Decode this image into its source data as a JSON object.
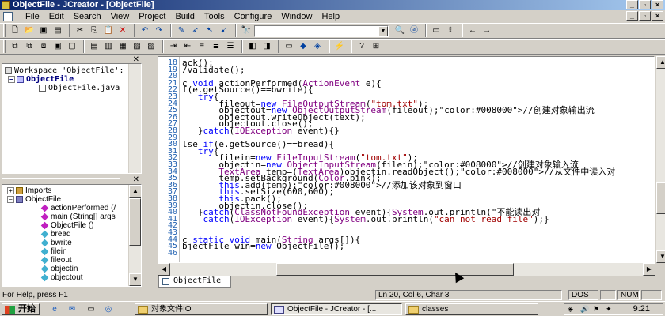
{
  "window": {
    "title": "ObjectFile - JCreator - [ObjectFile]"
  },
  "menu": [
    "File",
    "Edit",
    "Search",
    "View",
    "Project",
    "Build",
    "Tools",
    "Configure",
    "Window",
    "Help"
  ],
  "workspace": {
    "header": "Workspace 'ObjectFile':",
    "project": "ObjectFile",
    "file": "ObjectFile.java"
  },
  "classview": {
    "imports": "Imports",
    "class": "ObjectFile",
    "members": [
      "actionPerformed (/",
      "main (String[] args",
      "ObjectFile ()",
      "bread",
      "bwrite",
      "filein",
      "fileout",
      "objectin",
      "objectout"
    ]
  },
  "editor": {
    "lines": [
      {
        "n": "18",
        "t": "ack();"
      },
      {
        "n": "19",
        "t": "/validate();"
      },
      {
        "n": "20",
        "t": ""
      },
      {
        "n": "21",
        "t": "c void actionPerformed(ActionEvent e){"
      },
      {
        "n": "22",
        "t": "f(e.getSource()==bwrite){"
      },
      {
        "n": "23",
        "t": "   try{"
      },
      {
        "n": "24",
        "t": "       fileout=new FileOutputStream(\"tom.txt\");"
      },
      {
        "n": "25",
        "t": "       objectout=new ObjectOutputStream(fileout);//创建对象输出流"
      },
      {
        "n": "26",
        "t": "       objectout.writeObject(text);"
      },
      {
        "n": "27",
        "t": "       objectout.close();"
      },
      {
        "n": "28",
        "t": "   }catch(IOException event){}"
      },
      {
        "n": "29",
        "t": ""
      },
      {
        "n": "30",
        "t": "lse if(e.getSource()==bread){"
      },
      {
        "n": "31",
        "t": "   try{"
      },
      {
        "n": "32",
        "t": "       filein=new FileInputStream(\"tom.txt\");"
      },
      {
        "n": "33",
        "t": "       objectin=new ObjectInputStream(filein);//创建对象输入流"
      },
      {
        "n": "34",
        "t": "       TextArea temp=(TextArea)objectin.readObject();//从文件中读入对"
      },
      {
        "n": "35",
        "t": "       temp.setBackground(Color.pink);"
      },
      {
        "n": "36",
        "t": "       this.add(temp);//添加该对象到窗口"
      },
      {
        "n": "37",
        "t": "       this.setSize(600,600);"
      },
      {
        "n": "38",
        "t": "       this.pack();"
      },
      {
        "n": "39",
        "t": "       objectin.close();"
      },
      {
        "n": "40",
        "t": "   }catch(ClassNotFoundException event){System.out.println(\"不能读出对"
      },
      {
        "n": "41",
        "t": "    catch(IOException event){System.out.println(\"can not read file\");}"
      },
      {
        "n": "42",
        "t": ""
      },
      {
        "n": "43",
        "t": ""
      },
      {
        "n": "44",
        "t": "c static void main(String args[]){"
      },
      {
        "n": "45",
        "t": "bjectFile win=new ObjectFile();"
      },
      {
        "n": "46",
        "t": ""
      }
    ],
    "tab": "ObjectFile"
  },
  "status": {
    "help": "For Help, press F1",
    "position": "Ln 20, Col 6, Char 3",
    "dos": "DOS",
    "num": "NUM"
  },
  "taskbar": {
    "start": "开始",
    "tasks": [
      "对象文件IO",
      "ObjectFile - JCreator - [...",
      "classes"
    ],
    "clock": "9:21"
  },
  "colors": {
    "keyword": "#0000ff",
    "comment": "#008000",
    "string": "#a00000",
    "type": "#800080",
    "linenum": "#2060b0"
  }
}
